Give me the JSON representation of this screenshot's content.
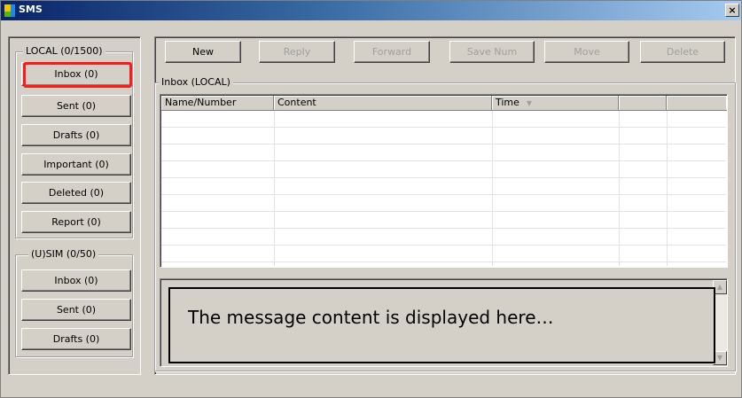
{
  "window": {
    "title": "SMS",
    "close_icon": "close-icon",
    "close_glyph": "×"
  },
  "sidebar": {
    "local": {
      "title": "LOCAL (0/1500)",
      "items": [
        {
          "label": "Inbox (0)",
          "selected": true
        },
        {
          "label": "Sent (0)"
        },
        {
          "label": "Drafts (0)"
        },
        {
          "label": "Important (0)"
        },
        {
          "label": "Deleted (0)"
        },
        {
          "label": "Report (0)"
        }
      ]
    },
    "sim": {
      "title": "(U)SIM (0/50)",
      "items": [
        {
          "label": "Inbox (0)"
        },
        {
          "label": "Sent (0)"
        },
        {
          "label": "Drafts (0)"
        }
      ]
    }
  },
  "toolbar": {
    "buttons": [
      {
        "label": "New",
        "enabled": true
      },
      {
        "label": "Reply",
        "enabled": false
      },
      {
        "label": "Forward",
        "enabled": false
      },
      {
        "label": "Save Num",
        "enabled": false
      },
      {
        "label": "Move",
        "enabled": false
      },
      {
        "label": "Delete",
        "enabled": false
      }
    ]
  },
  "inbox": {
    "title": "Inbox (LOCAL)",
    "columns": [
      "Name/Number",
      "Content",
      "Time",
      "",
      ""
    ],
    "sort_column": "Time",
    "sort_icon": "sort-down-icon",
    "sort_glyph": "▼",
    "rows": []
  },
  "message": {
    "text": "The message content is displayed here…"
  },
  "scrollbar": {
    "up_glyph": "▲",
    "down_glyph": "▼"
  },
  "colors": {
    "highlight": "#ff1a1a",
    "titlebar_start": "#0a246a",
    "titlebar_end": "#a6caf0"
  }
}
